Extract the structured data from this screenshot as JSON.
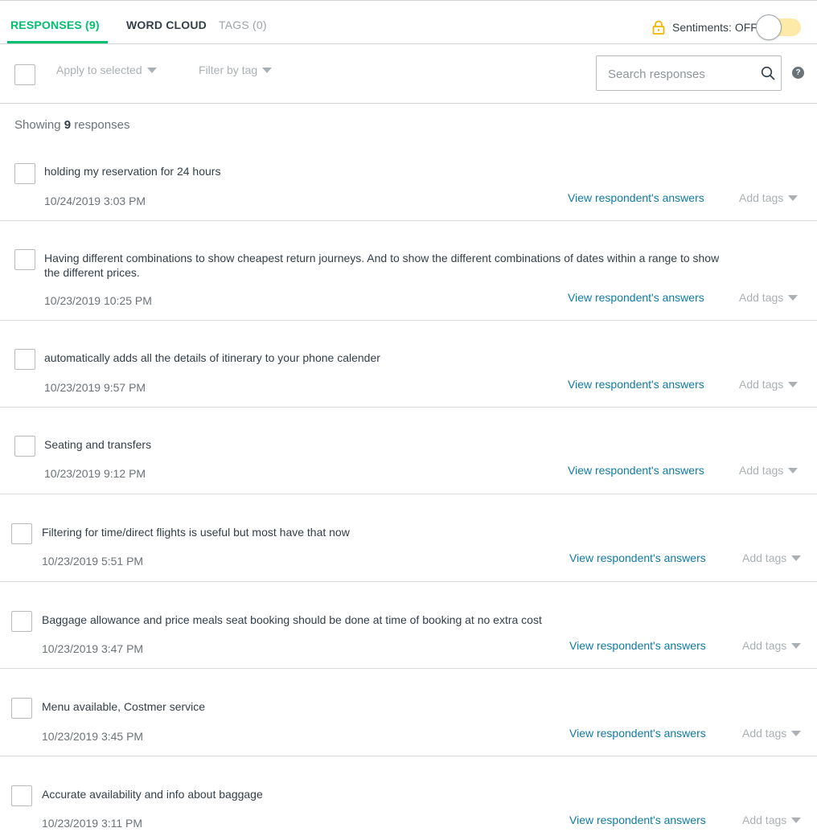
{
  "tabs": [
    {
      "label": "RESPONSES (9)"
    },
    {
      "label": "WORD CLOUD"
    },
    {
      "label": "TAGS (0)"
    }
  ],
  "sentiments": {
    "label": "Sentiments: OFF",
    "enabled": false
  },
  "colors": {
    "accent": "#00bf6f",
    "link": "#0f7aa6",
    "lock": "#f5b400",
    "toggle_track": "#fdeaa8"
  },
  "toolbar": {
    "apply_label": "Apply to selected",
    "filter_label": "Filter by tag",
    "search_placeholder": "Search responses"
  },
  "summary": {
    "prefix": "Showing",
    "count": "9",
    "suffix": "responses"
  },
  "row_actions": {
    "view_label": "View respondent's answers",
    "tags_label": "Add tags"
  },
  "responses": [
    {
      "text": "holding my reservation for 24 hours",
      "date": "10/24/2019 3:03 PM"
    },
    {
      "text": "Having different combinations to show cheapest return journeys. And to show the different combinations of dates within a range to show the different prices.",
      "date": "10/23/2019 10:25 PM"
    },
    {
      "text": "automatically adds all the details of itinerary to your phone calender",
      "date": "10/23/2019 9:57 PM"
    },
    {
      "text": "Seating and transfers",
      "date": "10/23/2019 9:12 PM"
    },
    {
      "text": "Filtering for time/direct flights is useful but most have that now",
      "date": "10/23/2019 5:51 PM"
    },
    {
      "text": "Baggage allowance and price meals seat booking should be done at time of booking at no extra cost",
      "date": "10/23/2019 3:47 PM"
    },
    {
      "text": "Menu available, Costmer service",
      "date": "10/23/2019 3:45 PM"
    },
    {
      "text": "Accurate availability and info about baggage",
      "date": "10/23/2019 3:11 PM"
    }
  ]
}
